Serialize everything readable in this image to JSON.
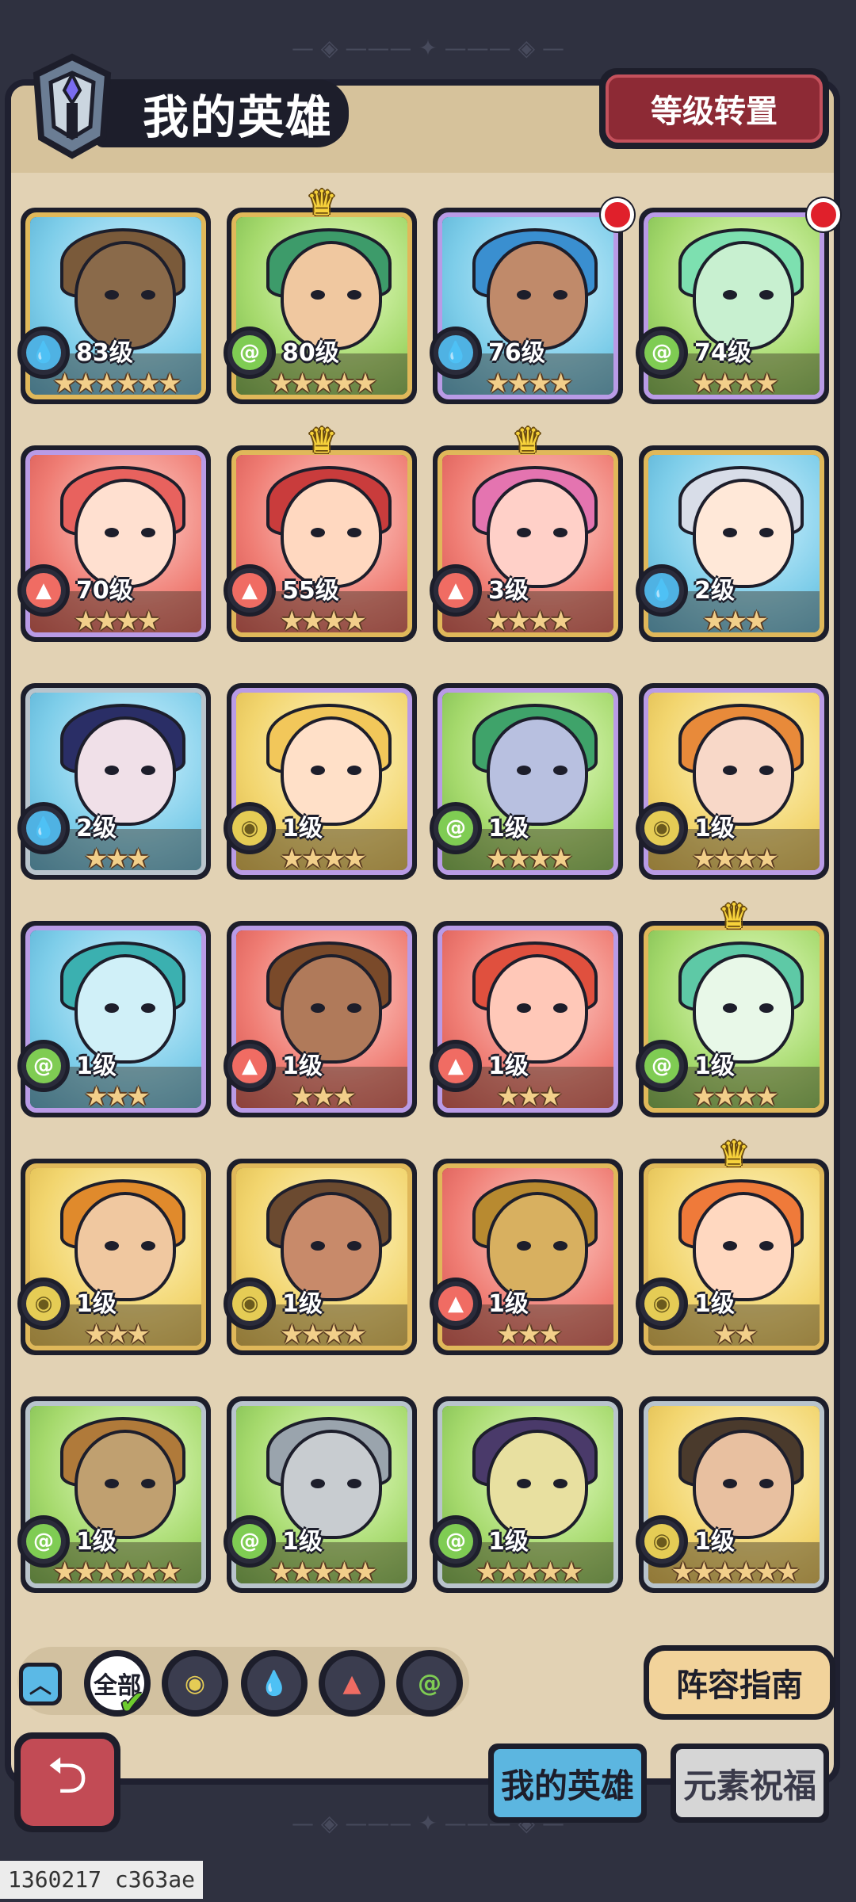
{
  "header": {
    "title": "我的英雄",
    "reset_button": "等级转置"
  },
  "heroes": [
    {
      "element": "water",
      "level": "83级",
      "stars": "★★★★★★",
      "rarity": "gold",
      "bg": "bg-blue",
      "crown": false,
      "dot": false
    },
    {
      "element": "wind",
      "level": "80级",
      "stars": "★★★★★",
      "rarity": "gold",
      "bg": "bg-green",
      "crown": true,
      "dot": false
    },
    {
      "element": "water",
      "level": "76级",
      "stars": "★★★★",
      "rarity": "purple",
      "bg": "bg-blue",
      "crown": false,
      "dot": true
    },
    {
      "element": "wind",
      "level": "74级",
      "stars": "★★★★",
      "rarity": "purple",
      "bg": "bg-green",
      "crown": false,
      "dot": true
    },
    {
      "element": "fire",
      "level": "70级",
      "stars": "★★★★",
      "rarity": "purple",
      "bg": "bg-red",
      "crown": false,
      "dot": false
    },
    {
      "element": "fire",
      "level": "55级",
      "stars": "★★★★",
      "rarity": "gold",
      "bg": "bg-red",
      "crown": true,
      "dot": false
    },
    {
      "element": "fire",
      "level": "3级",
      "stars": "★★★★",
      "rarity": "gold",
      "bg": "bg-red",
      "crown": true,
      "dot": false
    },
    {
      "element": "water",
      "level": "2级",
      "stars": "★★★",
      "rarity": "gold",
      "bg": "bg-blue",
      "crown": false,
      "dot": false
    },
    {
      "element": "water",
      "level": "2级",
      "stars": "★★★",
      "rarity": "silver",
      "bg": "bg-blue",
      "crown": false,
      "dot": false
    },
    {
      "element": "earth",
      "level": "1级",
      "stars": "★★★★",
      "rarity": "purple",
      "bg": "bg-yellow",
      "crown": false,
      "dot": false
    },
    {
      "element": "wind",
      "level": "1级",
      "stars": "★★★★",
      "rarity": "purple",
      "bg": "bg-green",
      "crown": false,
      "dot": false
    },
    {
      "element": "earth",
      "level": "1级",
      "stars": "★★★★",
      "rarity": "purple",
      "bg": "bg-yellow",
      "crown": false,
      "dot": false
    },
    {
      "element": "wind",
      "level": "1级",
      "stars": "★★★",
      "rarity": "purple",
      "bg": "bg-blue",
      "crown": false,
      "dot": false
    },
    {
      "element": "fire",
      "level": "1级",
      "stars": "★★★",
      "rarity": "purple",
      "bg": "bg-red",
      "crown": false,
      "dot": false
    },
    {
      "element": "fire",
      "level": "1级",
      "stars": "★★★",
      "rarity": "purple",
      "bg": "bg-red",
      "crown": false,
      "dot": false
    },
    {
      "element": "wind",
      "level": "1级",
      "stars": "★★★★",
      "rarity": "gold",
      "bg": "bg-green",
      "crown": true,
      "dot": false
    },
    {
      "element": "earth",
      "level": "1级",
      "stars": "★★★",
      "rarity": "gold",
      "bg": "bg-yellow",
      "crown": false,
      "dot": false
    },
    {
      "element": "earth",
      "level": "1级",
      "stars": "★★★★",
      "rarity": "gold",
      "bg": "bg-yellow",
      "crown": false,
      "dot": false
    },
    {
      "element": "fire",
      "level": "1级",
      "stars": "★★★",
      "rarity": "gold",
      "bg": "bg-red",
      "crown": false,
      "dot": false
    },
    {
      "element": "earth",
      "level": "1级",
      "stars": "★★",
      "rarity": "gold",
      "bg": "bg-yellow",
      "crown": true,
      "dot": false
    },
    {
      "element": "wind",
      "level": "1级",
      "stars": "★★★★★★",
      "rarity": "silver",
      "bg": "bg-green",
      "crown": false,
      "dot": false
    },
    {
      "element": "wind",
      "level": "1级",
      "stars": "★★★★★",
      "rarity": "silver",
      "bg": "bg-green",
      "crown": false,
      "dot": false
    },
    {
      "element": "wind",
      "level": "1级",
      "stars": "★★★★★",
      "rarity": "silver",
      "bg": "bg-green",
      "crown": false,
      "dot": false
    },
    {
      "element": "earth",
      "level": "1级",
      "stars": "★★★★★★",
      "rarity": "silver",
      "bg": "bg-yellow",
      "crown": false,
      "dot": false
    }
  ],
  "filter": {
    "all_label": "全部",
    "elements": [
      "earth",
      "water",
      "fire",
      "wind"
    ]
  },
  "guide_button": "阵容指南",
  "tabs": {
    "my_heroes": "我的英雄",
    "element_blessing": "元素祝福"
  },
  "watermark": "1360217 c363ae",
  "colors": {
    "water": "#4fb2e3",
    "fire": "#f06c63",
    "earth": "#e5cc55",
    "wind": "#7fcc53",
    "panel": "#e2d2b4",
    "background": "#2f3140"
  }
}
